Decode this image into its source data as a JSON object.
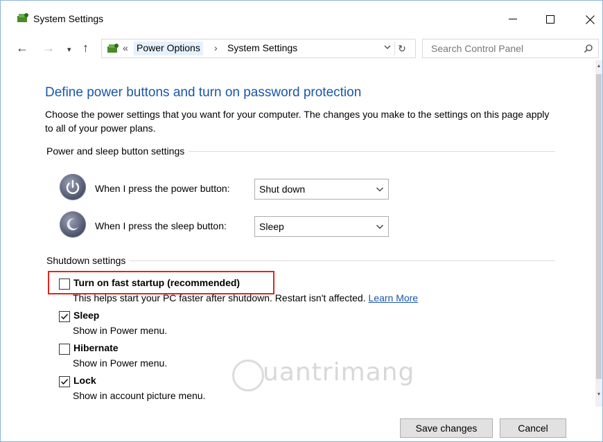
{
  "window": {
    "title": "System Settings"
  },
  "address": {
    "prefix": "«",
    "crumbs": [
      "Power Options",
      "System Settings"
    ],
    "separator": "›"
  },
  "search": {
    "placeholder": "Search Control Panel"
  },
  "page": {
    "heading": "Define power buttons and turn on password protection",
    "description": "Choose the power settings that you want for your computer. The changes you make to the settings on this page apply to all of your power plans."
  },
  "power_section": {
    "label": "Power and sleep button settings",
    "rows": [
      {
        "label": "When I press the power button:",
        "value": "Shut down"
      },
      {
        "label": "When I press the sleep button:",
        "value": "Sleep"
      }
    ]
  },
  "shutdown_section": {
    "label": "Shutdown settings",
    "items": [
      {
        "label": "Turn on fast startup (recommended)",
        "checked": false,
        "sub": "This helps start your PC faster after shutdown. Restart isn't affected.",
        "link": "Learn More"
      },
      {
        "label": "Sleep",
        "checked": true,
        "sub": "Show in Power menu."
      },
      {
        "label": "Hibernate",
        "checked": false,
        "sub": "Show in Power menu."
      },
      {
        "label": "Lock",
        "checked": true,
        "sub": "Show in account picture menu."
      }
    ]
  },
  "footer": {
    "save_label": "Save changes",
    "cancel_label": "Cancel"
  },
  "watermark": {
    "text": "uantrimang"
  },
  "colors": {
    "heading": "#1a56a8",
    "highlight": "#e3241b",
    "window_border": "#8cb4d9"
  }
}
